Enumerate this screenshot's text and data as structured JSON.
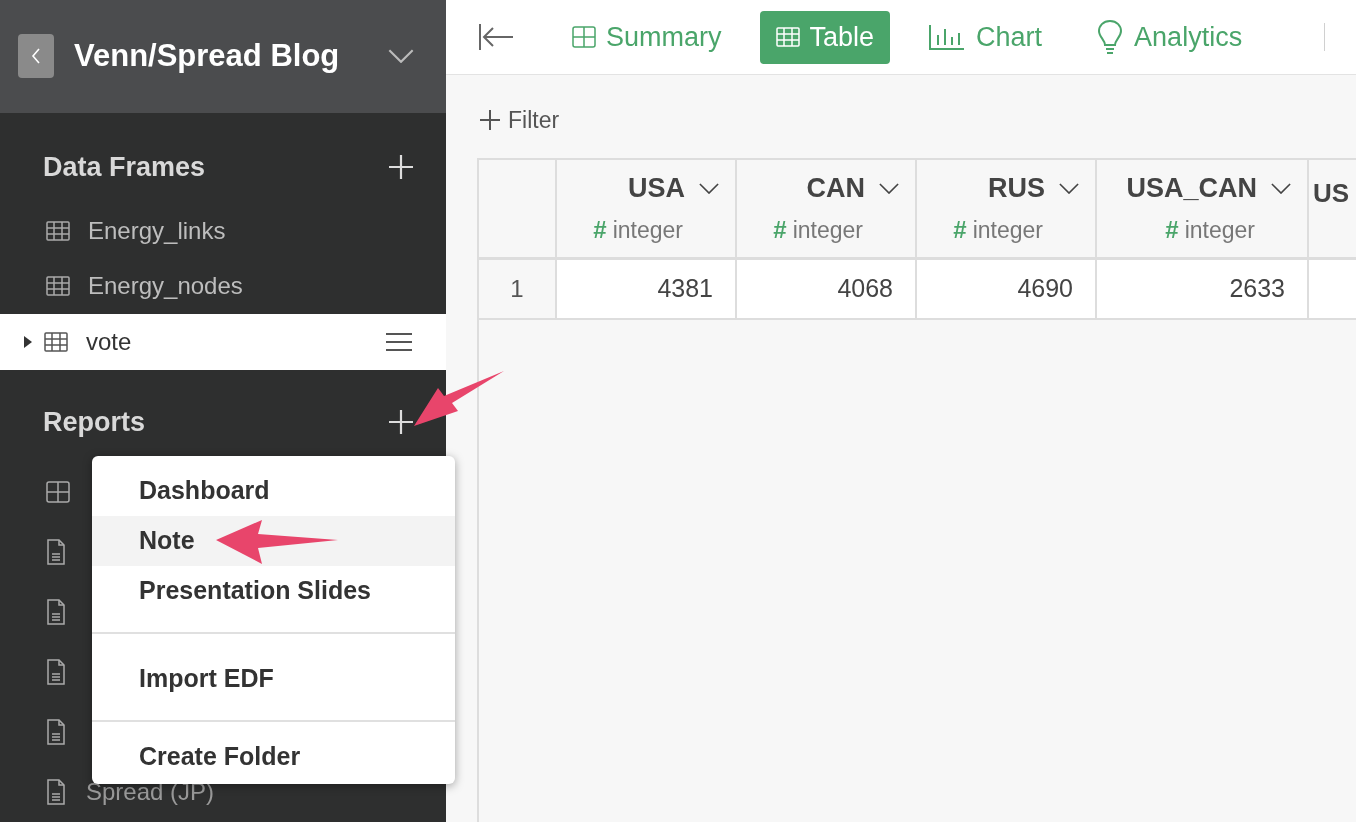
{
  "project": {
    "title": "Venn/Spread Blog"
  },
  "toolbar": {
    "tabs": [
      {
        "label": "Summary",
        "kind": "summary",
        "selected": false
      },
      {
        "label": "Table",
        "kind": "table",
        "selected": true
      },
      {
        "label": "Chart",
        "kind": "chart",
        "selected": false
      },
      {
        "label": "Analytics",
        "kind": "analytics",
        "selected": false
      }
    ]
  },
  "filter": {
    "label": "Filter"
  },
  "sidebar": {
    "data_frames": {
      "title": "Data Frames",
      "items": [
        {
          "label": "Energy_links",
          "selected": false
        },
        {
          "label": "Energy_nodes",
          "selected": false
        },
        {
          "label": "vote",
          "selected": true
        }
      ]
    },
    "reports": {
      "title": "Reports",
      "items": [
        {
          "kind": "dashboard"
        },
        {
          "kind": "note"
        },
        {
          "kind": "note"
        },
        {
          "kind": "note"
        },
        {
          "kind": "note"
        },
        {
          "label": "Spread (JP)",
          "kind": "note"
        }
      ]
    }
  },
  "table": {
    "columns": [
      {
        "name": "USA",
        "type_mark": "#",
        "type": "integer"
      },
      {
        "name": "CAN",
        "type_mark": "#",
        "type": "integer"
      },
      {
        "name": "RUS",
        "type_mark": "#",
        "type": "integer"
      },
      {
        "name": "USA_CAN",
        "type_mark": "#",
        "type": "integer"
      },
      {
        "name": "US"
      }
    ],
    "rows": [
      {
        "index": "1",
        "cells": [
          "4381",
          "4068",
          "4690",
          "2633",
          ""
        ]
      }
    ]
  },
  "menu": {
    "groups": [
      [
        {
          "label": "Dashboard",
          "selected": false
        },
        {
          "label": "Note",
          "selected": true
        },
        {
          "label": "Presentation Slides",
          "selected": false
        }
      ],
      [
        {
          "label": "Import EDF",
          "selected": false
        }
      ],
      [
        {
          "label": "Create Folder",
          "selected": false
        }
      ]
    ]
  }
}
